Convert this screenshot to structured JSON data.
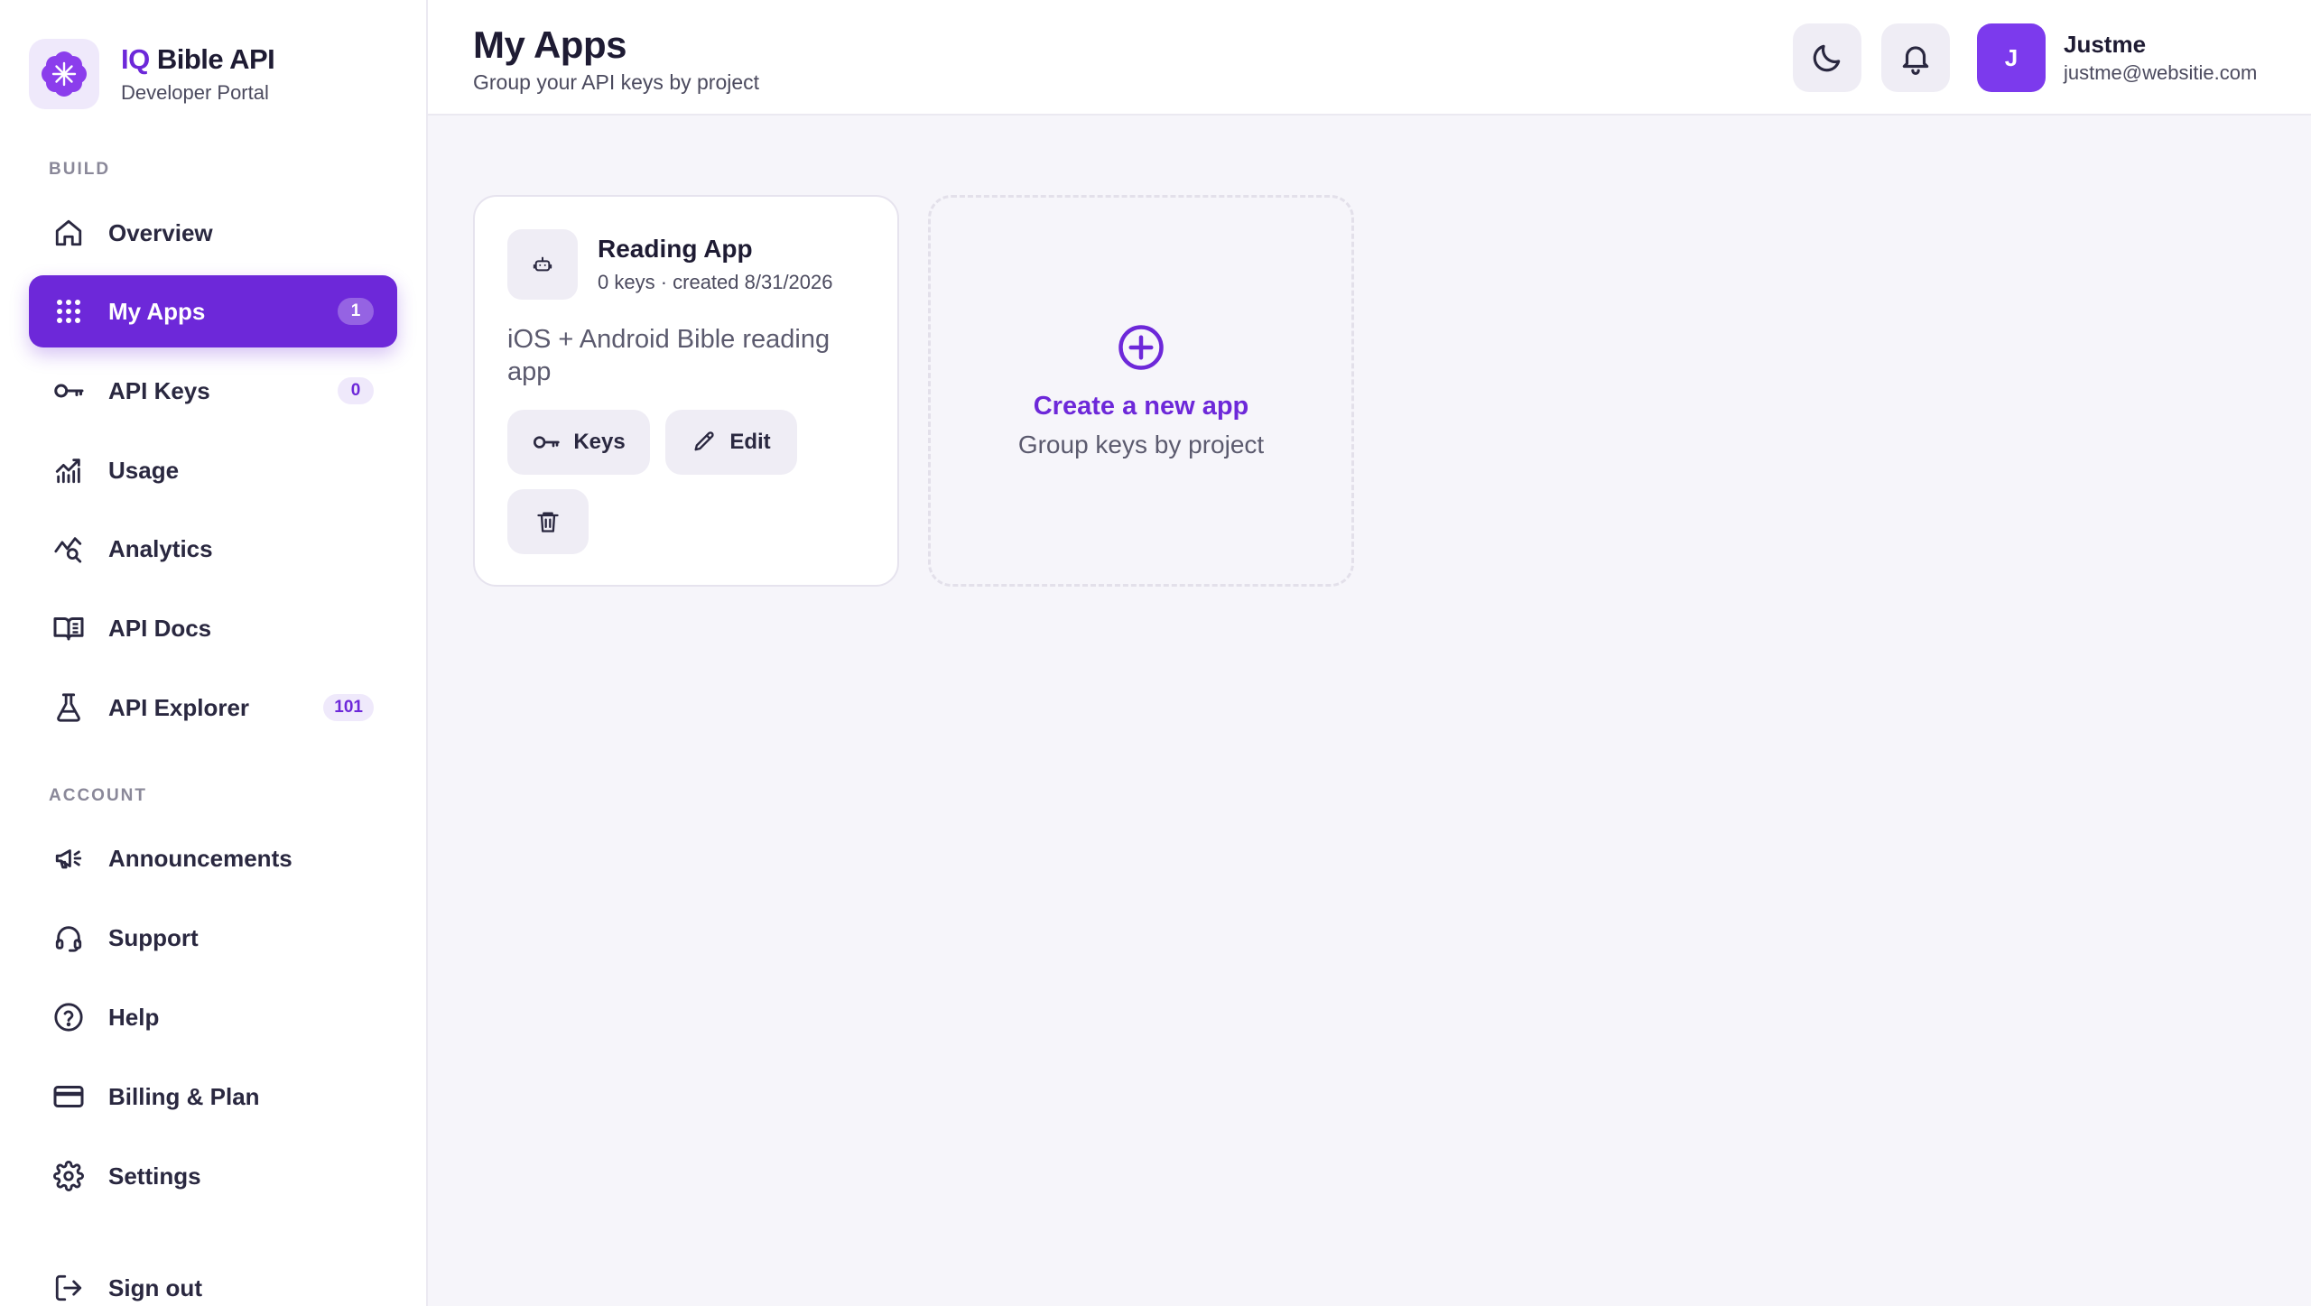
{
  "brand": {
    "title_accent": "IQ",
    "title_rest": " Bible API",
    "subtitle": "Developer Portal"
  },
  "colors": {
    "accent": "#6d28d9",
    "avatar": "#7c3aed",
    "badge_bg": "#efe9fb"
  },
  "sidebar": {
    "sections": [
      {
        "label": "BUILD",
        "items": [
          {
            "label": "Overview",
            "icon": "home-icon",
            "badge": null,
            "active": false
          },
          {
            "label": "My Apps",
            "icon": "grid-icon",
            "badge": "1",
            "active": true
          },
          {
            "label": "API Keys",
            "icon": "key-icon",
            "badge": "0",
            "active": false
          },
          {
            "label": "Usage",
            "icon": "usage-chart-icon",
            "badge": null,
            "active": false
          },
          {
            "label": "Analytics",
            "icon": "analytics-icon",
            "badge": null,
            "active": false
          },
          {
            "label": "API Docs",
            "icon": "book-icon",
            "badge": null,
            "active": false
          },
          {
            "label": "API Explorer",
            "icon": "flask-icon",
            "badge": "101",
            "active": false
          }
        ]
      },
      {
        "label": "ACCOUNT",
        "items": [
          {
            "label": "Announcements",
            "icon": "megaphone-icon"
          },
          {
            "label": "Support",
            "icon": "headset-icon"
          },
          {
            "label": "Help",
            "icon": "help-circle-icon"
          },
          {
            "label": "Billing & Plan",
            "icon": "credit-card-icon"
          },
          {
            "label": "Settings",
            "icon": "gear-icon"
          }
        ]
      }
    ],
    "sign_out": {
      "label": "Sign out",
      "icon": "sign-out-icon"
    }
  },
  "header": {
    "title": "My Apps",
    "subtitle": "Group your API keys by project",
    "theme_toggle_icon": "moon-icon",
    "notifications_icon": "bell-icon",
    "user": {
      "initial": "J",
      "name": "Justme",
      "email": "justme@websitie.com"
    }
  },
  "apps": [
    {
      "name": "Reading App",
      "meta": "0 keys · created 8/31/2026",
      "description": "iOS + Android Bible reading app",
      "icon": "robot-icon",
      "actions": {
        "keys_label": "Keys",
        "edit_label": "Edit",
        "delete_icon": "trash-icon"
      }
    }
  ],
  "new_app": {
    "title": "Create a new app",
    "subtitle": "Group keys by project",
    "icon": "plus-circle-icon"
  }
}
